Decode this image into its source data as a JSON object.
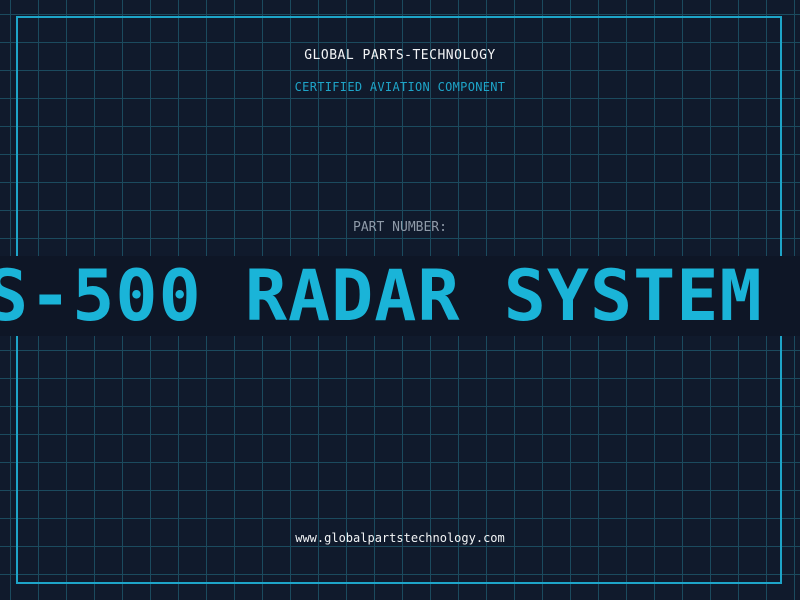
{
  "header": {
    "company": "GLOBAL PARTS-TECHNOLOGY",
    "tagline": "CERTIFIED AVIATION COMPONENT"
  },
  "part": {
    "label": "PART NUMBER:",
    "value": "S-500 RADAR SYSTEM"
  },
  "footer": {
    "website": "www.globalpartstechnology.com"
  },
  "colors": {
    "background": "#101a2c",
    "grid": "#1b4a5e",
    "accent": "#1ea4c8",
    "text": "#f2f4f6",
    "muted": "#8f9aa8"
  }
}
